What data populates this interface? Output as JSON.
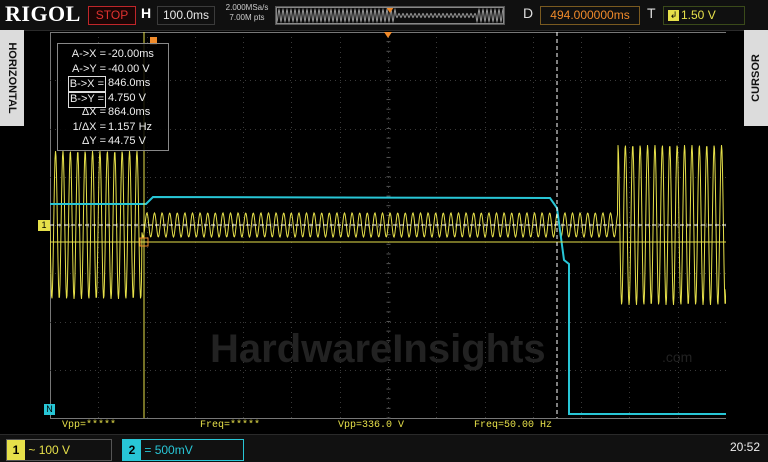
{
  "colors": {
    "ch1": "#e6e04a",
    "ch2": "#28c6d6",
    "accent": "#f08a2a",
    "stop": "#e0312f",
    "grid": "#555555"
  },
  "topbar": {
    "logo": "RIGOL",
    "run_state": "STOP",
    "horizontal_label": "H",
    "horizontal_scale": "100.0ms",
    "sample_rate": "2.000MSa/s",
    "memory_depth": "7.00M pts",
    "delay_label": "D",
    "delay_value": "494.000000ms",
    "trigger_label": "T",
    "trigger_channel": "1",
    "trigger_level": "1.50 V"
  },
  "side": {
    "left_menu": "HORIZONTAL",
    "right_menu": "CURSOR"
  },
  "cursor": {
    "rows": [
      {
        "key": "A->X =",
        "value": "-20.00ms"
      },
      {
        "key": "A->Y =",
        "value": "-40.00 V"
      },
      {
        "key": "B->X =",
        "value": "846.0ms"
      },
      {
        "key": "B->Y =",
        "value": "4.750 V"
      },
      {
        "key": "ΔX =",
        "value": "864.0ms"
      },
      {
        "key": "1/ΔX =",
        "value": "1.157 Hz"
      },
      {
        "key": "ΔY =",
        "value": "44.75 V"
      }
    ]
  },
  "measurements": [
    {
      "label": "Vpp=*****"
    },
    {
      "label": "Freq=*****"
    },
    {
      "label": "Vpp=336.0 V"
    },
    {
      "label": "Freq=50.00 Hz"
    }
  ],
  "watermark": "HardwareInsights",
  "watermark_suffix": ".com",
  "markers": {
    "ch1": "1",
    "ch2": "N",
    "trigger": "T"
  },
  "bottom": {
    "ch1": {
      "num": "1",
      "coupling": "~",
      "scale": "100 V"
    },
    "ch2": {
      "num": "2",
      "coupling": "=",
      "scale": "500mV"
    },
    "clock": "20:52"
  }
}
